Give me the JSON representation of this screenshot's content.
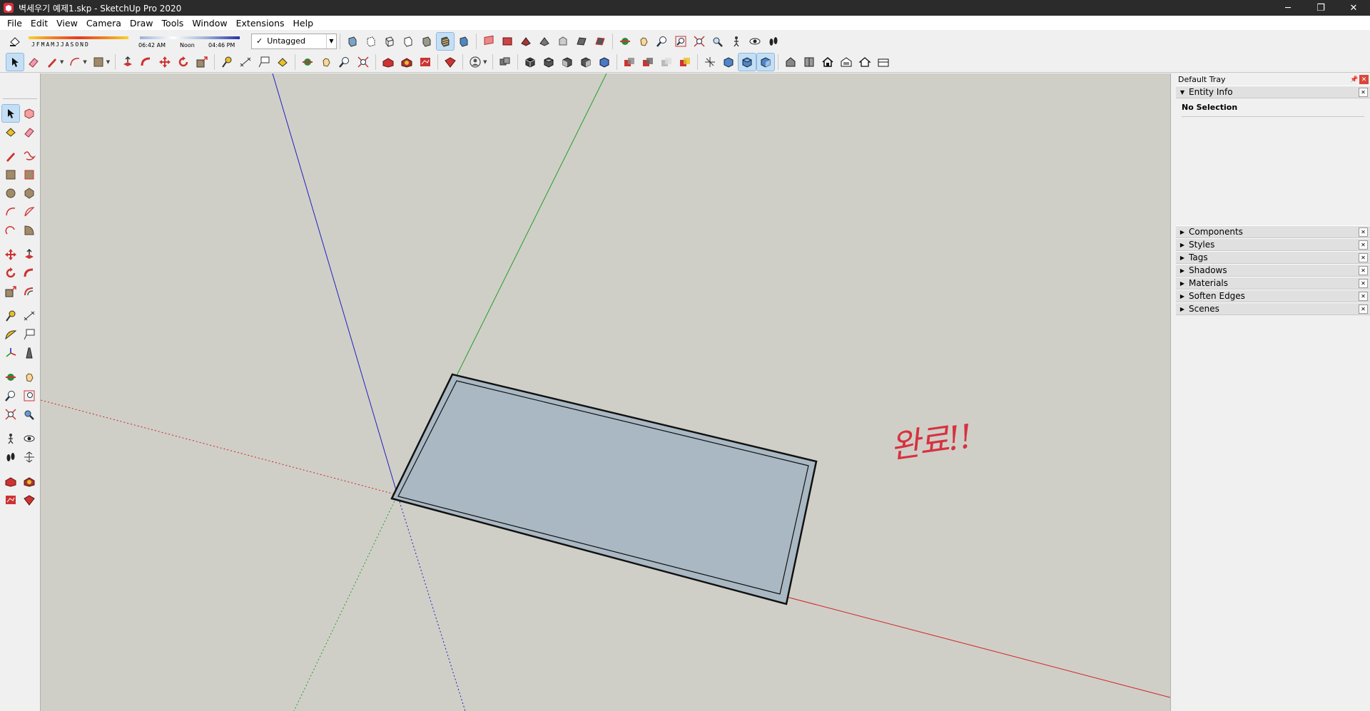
{
  "window": {
    "title": "벽세우기 예제1.skp - SketchUp Pro 2020",
    "minimize": "─",
    "restore": "❐",
    "close": "✕"
  },
  "menu": [
    "File",
    "Edit",
    "View",
    "Camera",
    "Draw",
    "Tools",
    "Window",
    "Extensions",
    "Help"
  ],
  "shadows": {
    "months": "JFMAMJJASOND",
    "time_start": "06:42 AM",
    "time_mid": "Noon",
    "time_end": "04:46 PM"
  },
  "tag_select": {
    "value": "Untagged"
  },
  "annotation": "완료!!",
  "tray": {
    "title": "Default Tray",
    "entity_info": {
      "label": "Entity Info",
      "content": "No Selection"
    },
    "panels": [
      "Components",
      "Styles",
      "Tags",
      "Shadows",
      "Materials",
      "Soften Edges",
      "Scenes"
    ]
  },
  "colors": {
    "axis_red": "#d42020",
    "axis_green": "#20a020",
    "axis_blue": "#2020c0",
    "face": "#a9b8c3",
    "viewport_bg": "#cfcfc8",
    "annotation": "#d8313f"
  }
}
